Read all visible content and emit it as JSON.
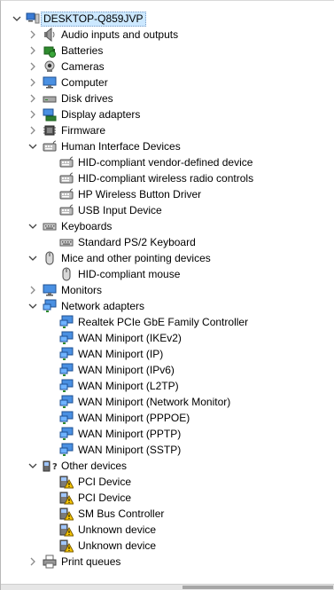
{
  "root": {
    "label": "DESKTOP-Q859JVP",
    "icon": "computer-icon",
    "expanded": true
  },
  "categories": [
    {
      "label": "Audio inputs and outputs",
      "icon": "speaker-icon",
      "expanded": false
    },
    {
      "label": "Batteries",
      "icon": "battery-icon",
      "expanded": false
    },
    {
      "label": "Cameras",
      "icon": "camera-icon",
      "expanded": false
    },
    {
      "label": "Computer",
      "icon": "monitor-icon",
      "expanded": false
    },
    {
      "label": "Disk drives",
      "icon": "disk-drive-icon",
      "expanded": false
    },
    {
      "label": "Display adapters",
      "icon": "display-adapter-icon",
      "expanded": false
    },
    {
      "label": "Firmware",
      "icon": "firmware-icon",
      "expanded": false
    },
    {
      "label": "Human Interface Devices",
      "icon": "hid-icon",
      "expanded": true,
      "children": [
        {
          "label": "HID-compliant vendor-defined device",
          "icon": "hid-icon"
        },
        {
          "label": "HID-compliant wireless radio controls",
          "icon": "hid-icon"
        },
        {
          "label": "HP Wireless Button Driver",
          "icon": "hid-icon"
        },
        {
          "label": "USB Input Device",
          "icon": "hid-icon"
        }
      ]
    },
    {
      "label": "Keyboards",
      "icon": "keyboard-icon",
      "expanded": true,
      "children": [
        {
          "label": "Standard PS/2 Keyboard",
          "icon": "keyboard-icon"
        }
      ]
    },
    {
      "label": "Mice and other pointing devices",
      "icon": "mouse-icon",
      "expanded": true,
      "children": [
        {
          "label": "HID-compliant mouse",
          "icon": "mouse-icon"
        }
      ]
    },
    {
      "label": "Monitors",
      "icon": "monitor-icon",
      "expanded": false
    },
    {
      "label": "Network adapters",
      "icon": "network-adapter-icon",
      "expanded": true,
      "children": [
        {
          "label": "Realtek PCIe GbE Family Controller",
          "icon": "network-adapter-icon"
        },
        {
          "label": "WAN Miniport (IKEv2)",
          "icon": "network-adapter-icon"
        },
        {
          "label": "WAN Miniport (IP)",
          "icon": "network-adapter-icon"
        },
        {
          "label": "WAN Miniport (IPv6)",
          "icon": "network-adapter-icon"
        },
        {
          "label": "WAN Miniport (L2TP)",
          "icon": "network-adapter-icon"
        },
        {
          "label": "WAN Miniport (Network Monitor)",
          "icon": "network-adapter-icon"
        },
        {
          "label": "WAN Miniport (PPPOE)",
          "icon": "network-adapter-icon"
        },
        {
          "label": "WAN Miniport (PPTP)",
          "icon": "network-adapter-icon"
        },
        {
          "label": "WAN Miniport (SSTP)",
          "icon": "network-adapter-icon"
        }
      ]
    },
    {
      "label": "Other devices",
      "icon": "other-devices-icon",
      "expanded": true,
      "children": [
        {
          "label": "PCI Device",
          "icon": "warning-device-icon"
        },
        {
          "label": "PCI Device",
          "icon": "warning-device-icon"
        },
        {
          "label": "SM Bus Controller",
          "icon": "warning-device-icon"
        },
        {
          "label": "Unknown device",
          "icon": "warning-device-icon"
        },
        {
          "label": "Unknown device",
          "icon": "warning-device-icon"
        }
      ]
    },
    {
      "label": "Print queues",
      "icon": "printer-icon",
      "expanded": false
    }
  ]
}
